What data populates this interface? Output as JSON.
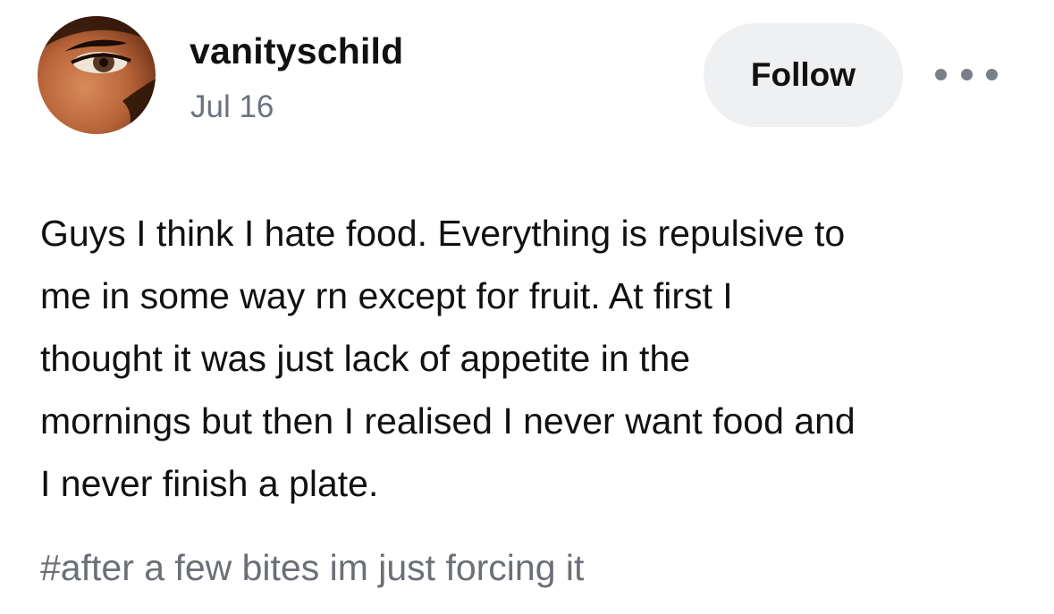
{
  "post": {
    "username": "vanityschild",
    "date": "Jul 16",
    "follow_label": "Follow",
    "more_icon": "ellipsis-icon",
    "body_lines": [
      "Guys I think I hate food. Everything is repulsive to",
      "me in some way rn except for fruit. At first I",
      "thought it was just lack of appetite in the",
      "mornings but then I realised I never want food and",
      "I never finish a plate."
    ],
    "tags": [
      "#after a few bites im just forcing it"
    ]
  },
  "colors": {
    "follow_bg": "#eff0f2",
    "date_text": "#6b7280",
    "tag_text": "#6b6f76"
  }
}
